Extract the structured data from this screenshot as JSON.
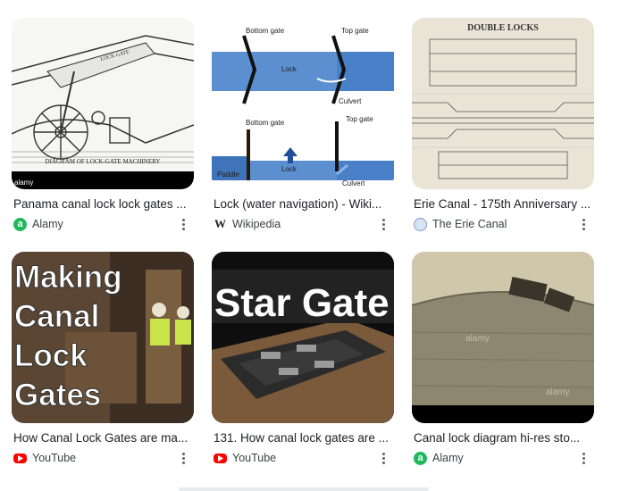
{
  "results": [
    {
      "title": "Panama canal lock lock gates ...",
      "source": "Alamy",
      "source_icon": "alamy-icon",
      "thumb_text": [
        "LOCK GATE",
        "DIAGRAM OF LOCK-GATE MACHINERY",
        "alamy"
      ]
    },
    {
      "title": "Lock (water navigation) - Wiki...",
      "source": "Wikipedia",
      "source_icon": "wikipedia-icon",
      "thumb_text": [
        "Bottom gate",
        "Top gate",
        "Lock",
        "Culvert",
        "Bottom gate",
        "Top gate",
        "Paddle",
        "Lock",
        "Culvert"
      ]
    },
    {
      "title": "Erie Canal - 175th Anniversary ...",
      "source": "The Erie Canal",
      "source_icon": "erie-canal-icon",
      "thumb_text": [
        "DOUBLE LOCKS"
      ]
    },
    {
      "title": "How Canal Lock Gates are ma...",
      "source": "YouTube",
      "source_icon": "youtube-icon",
      "thumb_text": [
        "Making",
        "Canal",
        "Lock",
        "Gates"
      ]
    },
    {
      "title": "131. How canal lock gates are ...",
      "source": "YouTube",
      "source_icon": "youtube-icon",
      "thumb_text": [
        "Star Gate"
      ]
    },
    {
      "title": "Canal lock diagram hi-res sto...",
      "source": "Alamy",
      "source_icon": "alamy-icon",
      "thumb_text": [
        "alamy",
        "alamy"
      ]
    }
  ],
  "colors": {
    "alamy_green": "#1fb85a",
    "youtube_red": "#ff0000",
    "wiki_blue": "#4a80c8",
    "water_blue": "#5b8fd0"
  }
}
